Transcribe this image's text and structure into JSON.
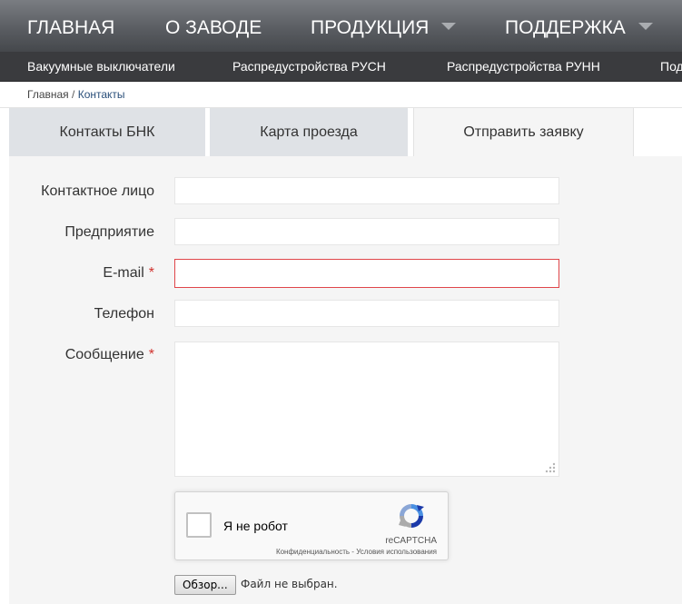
{
  "top_nav": {
    "items": [
      {
        "label": "ГЛАВНАЯ",
        "has_dropdown": false
      },
      {
        "label": "О ЗАВОДЕ",
        "has_dropdown": false
      },
      {
        "label": "ПРОДУКЦИЯ",
        "has_dropdown": true
      },
      {
        "label": "ПОДДЕРЖКА",
        "has_dropdown": true
      }
    ]
  },
  "sub_nav": {
    "items": [
      {
        "label": "Вакуумные выключатели"
      },
      {
        "label": "Распредустройства РУСН"
      },
      {
        "label": "Распредустройства РУНН"
      },
      {
        "label": "Под"
      }
    ]
  },
  "breadcrumb": {
    "home": "Главная",
    "separator": "/",
    "current": "Контакты"
  },
  "tabs": [
    {
      "label": "Контакты БНК",
      "active": false
    },
    {
      "label": "Карта проезда",
      "active": false
    },
    {
      "label": "Отправить заявку",
      "active": true
    }
  ],
  "form": {
    "contact_label": "Контактное лицо",
    "company_label": "Предприятие",
    "email_label": "E-mail",
    "phone_label": "Телефон",
    "message_label": "Сообщение",
    "required_mark": "*",
    "contact_value": "",
    "company_value": "",
    "email_value": "",
    "phone_value": "",
    "message_value": ""
  },
  "recaptcha": {
    "checkbox_label": "Я не робот",
    "brand": "reCAPTCHA",
    "terms": "Конфиденциальность - Условия использования",
    "checked": false
  },
  "file_upload": {
    "button_label": "Обзор...",
    "status": "Файл не выбран."
  },
  "colors": {
    "nav_bg": "#5a5d62",
    "subnav_bg": "#3a3b3e",
    "panel_bg": "#f5f5f5",
    "inactive_tab_bg": "#dfe2e6",
    "required_red": "#d0312d",
    "error_border": "#e0464a"
  }
}
